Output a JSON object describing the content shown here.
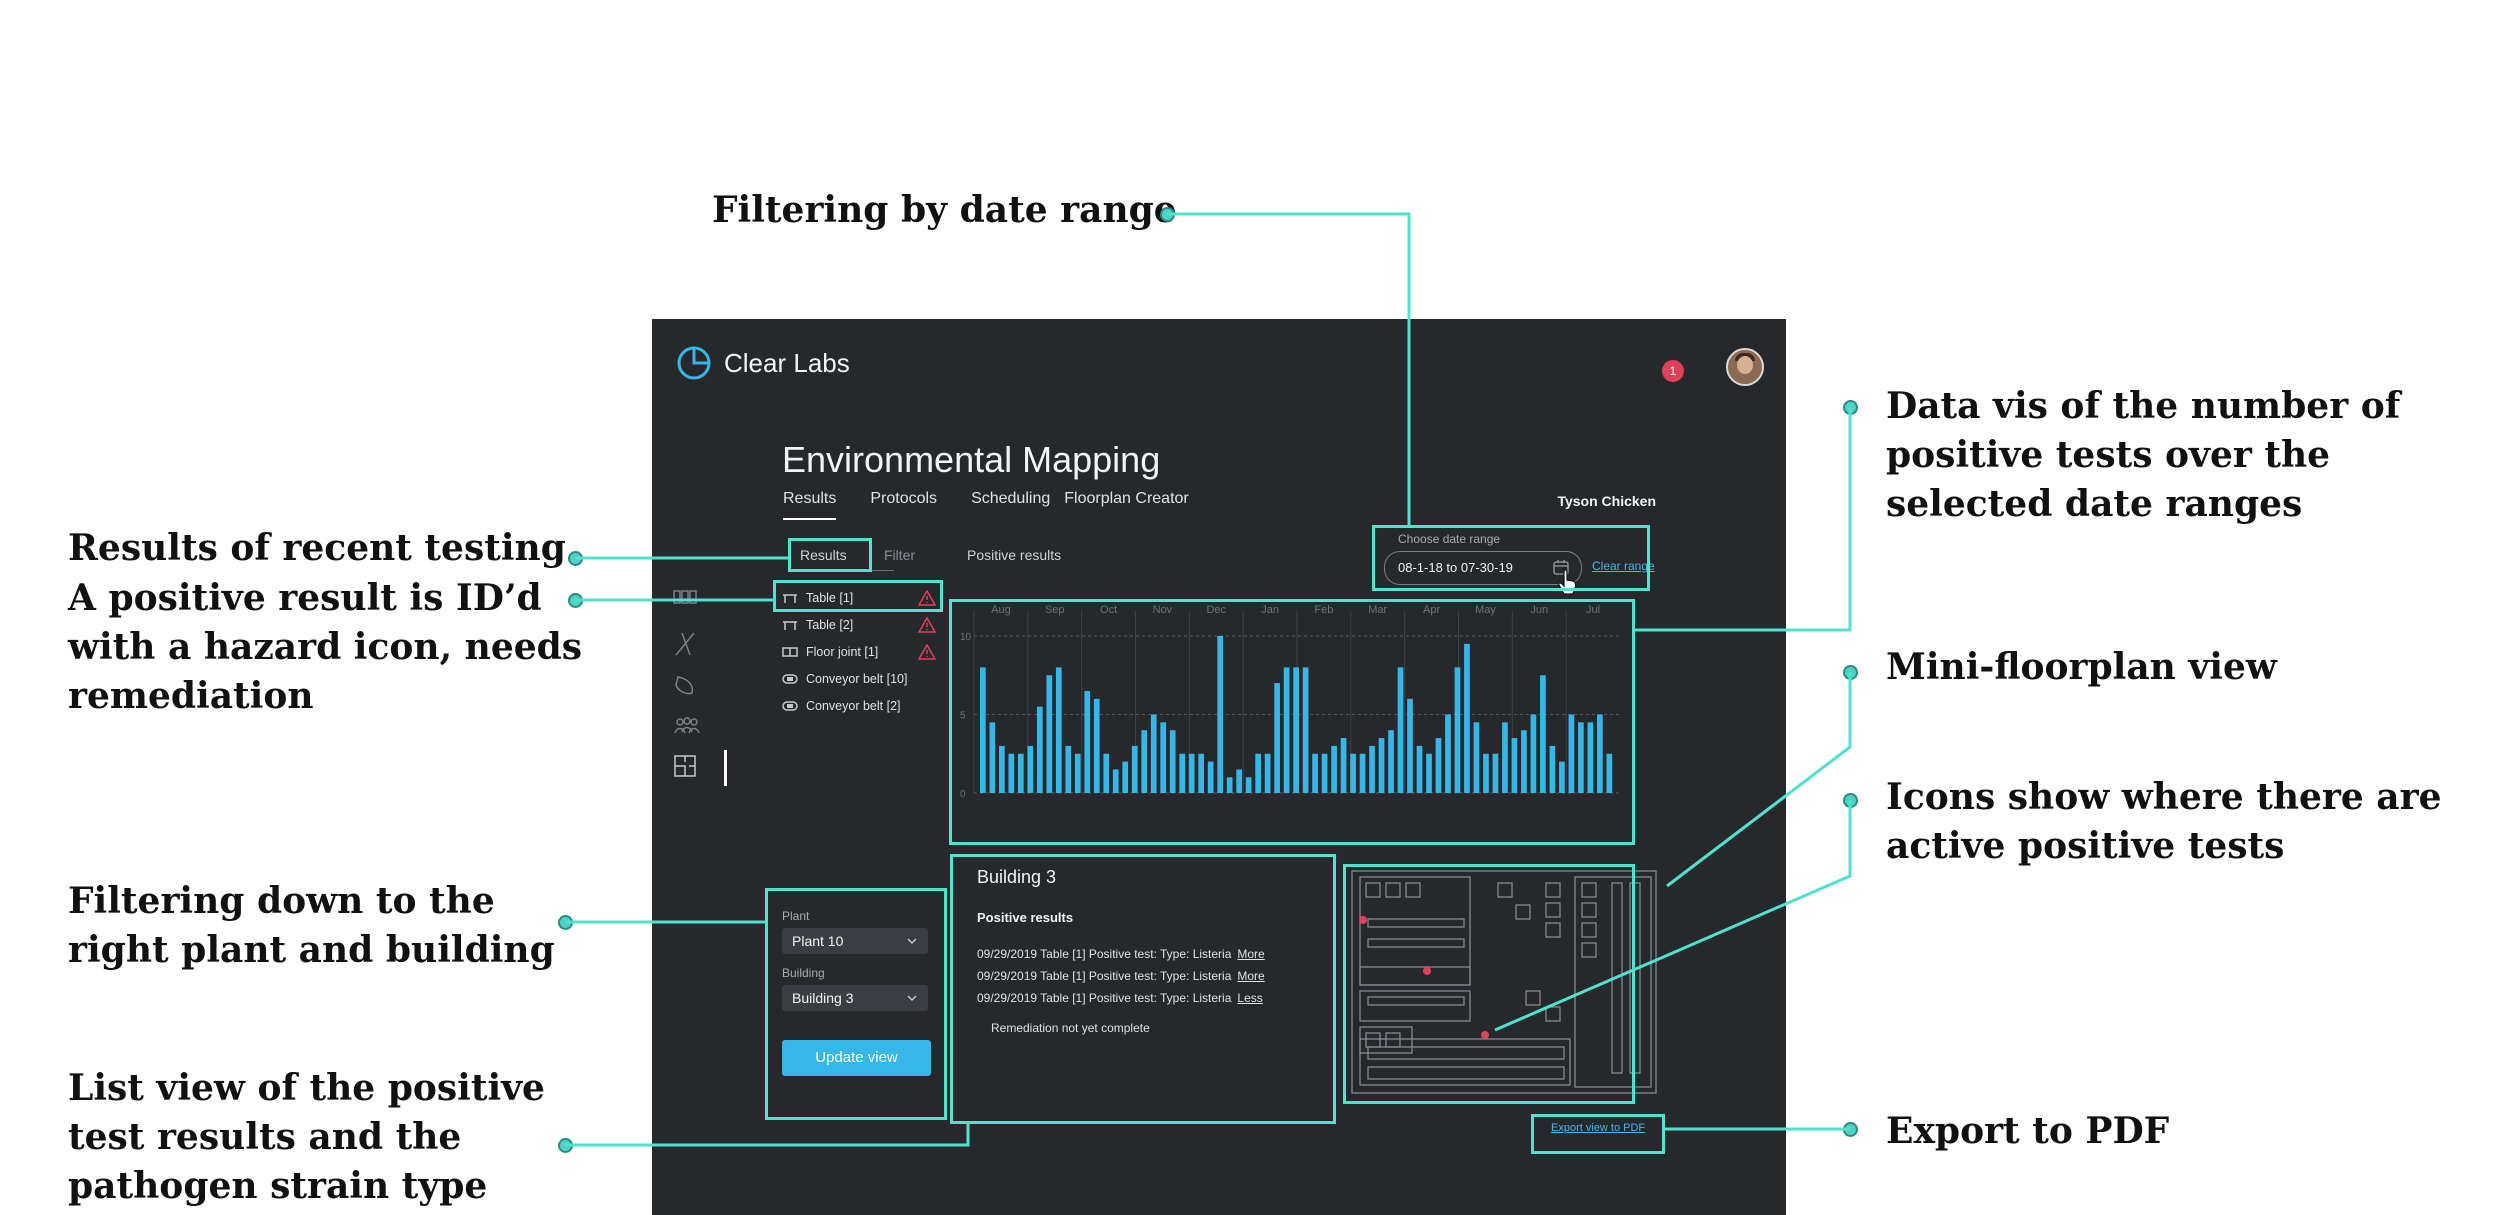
{
  "callouts": {
    "date_range": "Filtering by date range",
    "data_vis": "Data vis of the number of\npositive tests over the\nselected date ranges",
    "recent_testing": "Results of recent testing",
    "positive_result": "A positive result is ID’d\nwith a hazard icon, needs\nremediation",
    "mini_floorplan": "Mini-floorplan view",
    "icons_positive": "Icons show where there are\nactive positive tests",
    "filter_plant": "Filtering down to the\nright plant and building",
    "list_view": "List view of the positive\ntest results and the\npathogen strain type",
    "export_pdf": "Export to PDF"
  },
  "app": {
    "brand": "Clear Labs",
    "notification_count": "1",
    "page_title": "Environmental Mapping",
    "tabs": [
      "Results",
      "Protocols",
      "Scheduling",
      "Floorplan Creator"
    ],
    "organization": "Tyson Chicken",
    "subtabs": [
      "Results",
      "Filter",
      "Positive results"
    ],
    "date_range": {
      "label": "Choose date range",
      "value": "08-1-18 to 07-30-19",
      "clear": "Clear range"
    },
    "results": [
      {
        "label": "Table [1]",
        "icon": "table-icon",
        "hazard": true
      },
      {
        "label": "Table [2]",
        "icon": "table-icon",
        "hazard": true
      },
      {
        "label": "Floor joint [1]",
        "icon": "floor-joint-icon",
        "hazard": true
      },
      {
        "label": "Conveyor belt [10]",
        "icon": "conveyor-icon",
        "hazard": false
      },
      {
        "label": "Conveyor belt [2]",
        "icon": "conveyor-icon",
        "hazard": false
      }
    ],
    "filters": {
      "plant_label": "Plant",
      "plant_value": "Plant 10",
      "building_label": "Building",
      "building_value": "Building 3",
      "update_button": "Update view"
    },
    "detail": {
      "title": "Building 3",
      "subtitle": "Positive results",
      "rows": [
        {
          "text": "09/29/2019 Table [1] Positive test: Type: Listeria",
          "link": "More"
        },
        {
          "text": "09/29/2019 Table [1] Positive test: Type: Listeria",
          "link": "More"
        },
        {
          "text": "09/29/2019 Table [1] Positive test: Type: Listeria",
          "link": "Less"
        }
      ],
      "note": "Remediation not yet complete"
    },
    "export_link": "Export view to PDF",
    "colors": {
      "accent": "#35b7e8",
      "highlight": "#4fe3cf",
      "hazard": "#e0415a",
      "background": "#26282c"
    }
  },
  "chart_data": {
    "type": "bar",
    "title": "",
    "xlabel": "",
    "ylabel": "",
    "ylim": [
      0,
      10
    ],
    "yticks": [
      0,
      5,
      10
    ],
    "month_labels": [
      "Aug",
      "Sep",
      "Oct",
      "Nov",
      "Dec",
      "Jan",
      "Feb",
      "Mar",
      "Apr",
      "May",
      "Jun",
      "Jul"
    ],
    "values": [
      8,
      4.5,
      3,
      2.5,
      2.5,
      3,
      5.5,
      7.5,
      8,
      3,
      2.5,
      6.5,
      6,
      2.5,
      1.5,
      2,
      3,
      4,
      5,
      4.5,
      4,
      2.5,
      2.5,
      2.5,
      2,
      10,
      1,
      1.5,
      1,
      2.5,
      2.5,
      7,
      8,
      8,
      8,
      2.5,
      2.5,
      3,
      3.5,
      2.5,
      2.5,
      3,
      3.5,
      4,
      8,
      6,
      3,
      2.5,
      3.5,
      5,
      8,
      9.5,
      4.5,
      2.5,
      2.5,
      4.5,
      3.5,
      4,
      5,
      7.5,
      3,
      2,
      5,
      4.5,
      4.5,
      5,
      2.5
    ],
    "grid": true
  }
}
